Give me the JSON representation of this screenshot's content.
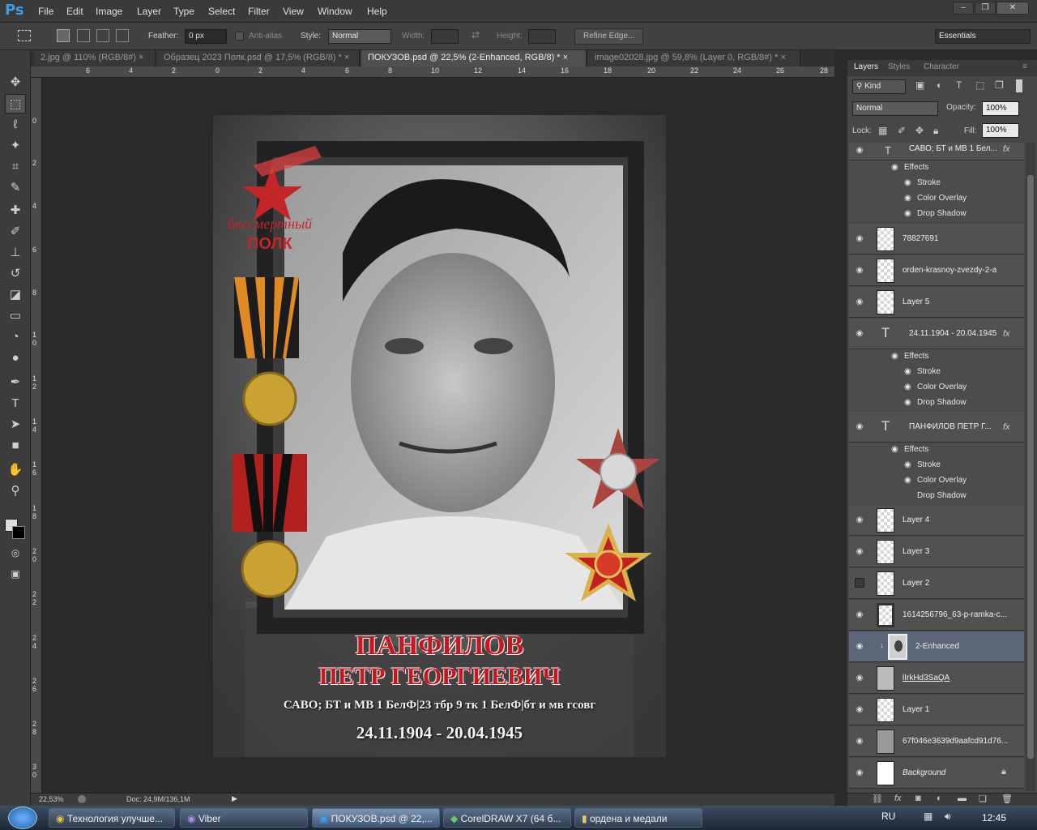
{
  "app": {
    "logo": "Ps"
  },
  "menu": [
    "File",
    "Edit",
    "Image",
    "Layer",
    "Type",
    "Select",
    "Filter",
    "View",
    "Window",
    "Help"
  ],
  "window_controls": [
    "–",
    "❐",
    "✕"
  ],
  "options": {
    "feather_label": "Feather:",
    "feather_value": "0 px",
    "antialias": "Anti-alias",
    "style_label": "Style:",
    "style_value": "Normal",
    "width_label": "Width:",
    "height_label": "Height:",
    "refine": "Refine Edge...",
    "workspace": "Essentials"
  },
  "tabs": [
    "2.jpg @ 110% (RGB/8#)",
    "Образец 2023 Полк.psd @ 17,5% (RGB/8) *",
    "ПОКУЗОВ.psd @ 22,5% (2-Enhanced, RGB/8) *",
    "image02028.jpg @ 59,8% (Layer 0, RGB/8#) *"
  ],
  "tab_close": "×",
  "ruler_top": [
    "6",
    "4",
    "2",
    "0",
    "2",
    "4",
    "6",
    "8",
    "10",
    "12",
    "14",
    "16",
    "18",
    "20",
    "22",
    "24",
    "26",
    "28"
  ],
  "ruler_left": [
    "0",
    "2",
    "4",
    "6",
    "8",
    "1 0",
    "1 2",
    "1 4",
    "1 6",
    "1 8",
    "2 0",
    "2 2",
    "2 4",
    "2 6",
    "2 8",
    "3 0"
  ],
  "document": {
    "logo_line1": "бессмертный",
    "logo_line2": "ПОЛК",
    "surname": "ПАНФИЛОВ",
    "given_names": "ПЕТР ГЕОРГИЕВИЧ",
    "service": "САВО; БТ и МВ 1 БелФ|23 тбр 9 тк 1 БелФ|бт и мв гсовг",
    "dates": "24.11.1904 - 20.04.1945"
  },
  "status": {
    "zoom": "22,53%",
    "doc": "Doc: 24,9M/136,1M"
  },
  "panel_tabs": [
    "Layers",
    "Styles",
    "Character"
  ],
  "layers_controls": {
    "kind": "Kind",
    "blend": "Normal",
    "opacity_label": "Opacity:",
    "opacity": "100%",
    "lock_label": "Lock:",
    "fill_label": "Fill:",
    "fill": "100%"
  },
  "fx_labels": {
    "effects": "Effects",
    "stroke": "Stroke",
    "color_overlay": "Color Overlay",
    "drop_shadow": "Drop Shadow",
    "fx": "fx"
  },
  "layers": {
    "top_text": "САВО; БТ и МВ 1 Бел...",
    "l1": "78827691",
    "l2": "orden-krasnoy-zvezdy-2-a",
    "l3": "Layer 5",
    "l4": "24.11.1904 - 20.04.1945",
    "l5": "ПАНФИЛОВ ПЕТР Г...",
    "l6": "Layer 4",
    "l7": "Layer 3",
    "l8": "Layer 2",
    "l9": "1614256796_63-p-ramka-c...",
    "l10": "2-Enhanced",
    "l11": "lIrkHd3SaQA",
    "l12": "Layer 1",
    "l13": "67f046e3639d9aafcd91d76...",
    "l14": "Background"
  },
  "taskbar": {
    "t1": "Технология улучше...",
    "t2": "Viber",
    "t3": "ПОКУЗОВ.psd @ 22,...",
    "t4": "CorelDRAW X7 (64 б...",
    "t5": "ордена и медали",
    "lang": "RU",
    "time": "12:45"
  }
}
